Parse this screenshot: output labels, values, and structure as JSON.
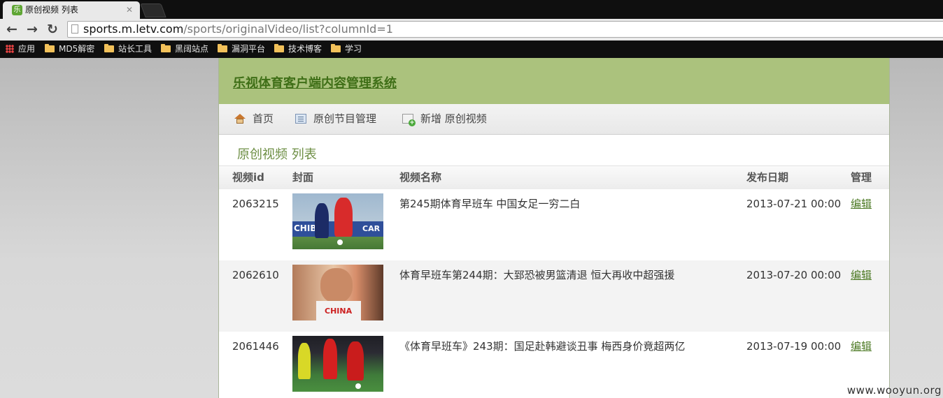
{
  "browser": {
    "tab_title": "原创视频 列表",
    "favicon": "乐",
    "url_host": "sports.m.letv.com",
    "url_path": "/sports/originalVideo/list?columnId=1",
    "bookmarks": [
      "应用",
      "MD5解密",
      "站长工具",
      "黑阔站点",
      "漏洞平台",
      "技术博客",
      "学习"
    ]
  },
  "header": {
    "title": "乐视体育客户端内容管理系统"
  },
  "nav": {
    "home": "首页",
    "program": "原创节目管理",
    "add": "新增 原创视频"
  },
  "section_title": "原创视频 列表",
  "table": {
    "columns": [
      "视频id",
      "封面",
      "视频名称",
      "发布日期",
      "管理"
    ],
    "rows": [
      {
        "id": "2063215",
        "title": "第245期体育早班车 中国女足一穷二白",
        "date": "2013-07-21 00:00",
        "action": "编辑"
      },
      {
        "id": "2062610",
        "title": "体育早班车第244期：大郅恐被男篮清退 恒大再收中超强援",
        "date": "2013-07-20 00:00",
        "action": "编辑"
      },
      {
        "id": "2061446",
        "title": "《体育早班车》243期：国足赴韩避谈丑事 梅西身价竟超两亿",
        "date": "2013-07-19 00:00",
        "action": "编辑"
      }
    ]
  },
  "cover_text": {
    "chiba": "CHIBA",
    "car": "CAR",
    "china": "CHINA"
  },
  "watermark": "www.wooyun.org"
}
